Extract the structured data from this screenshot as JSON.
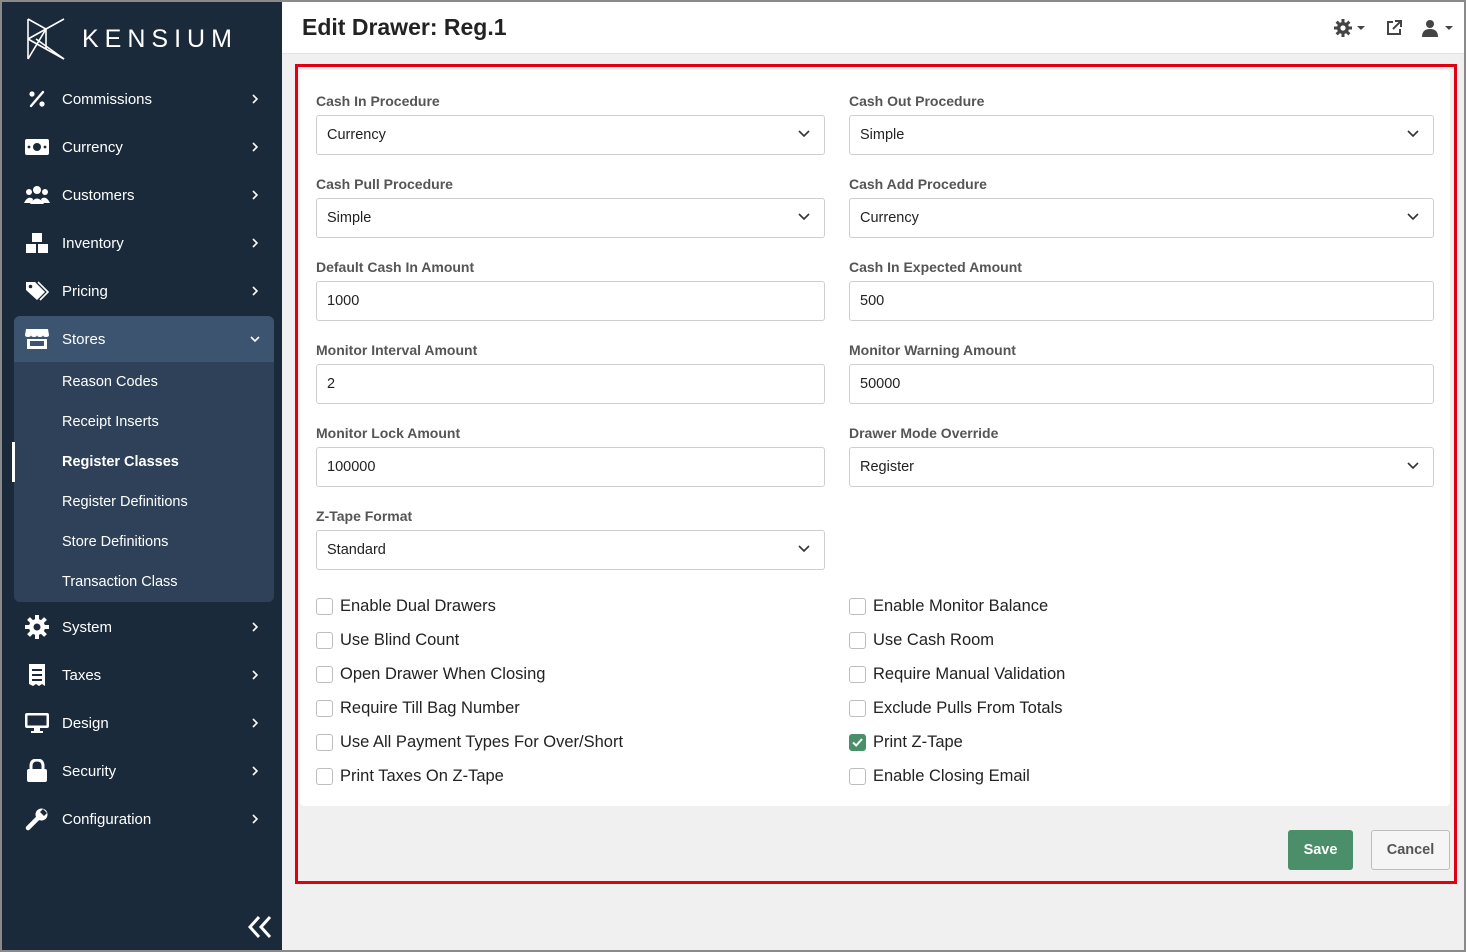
{
  "brand": {
    "name": "KENSIUM"
  },
  "sidebar": {
    "items": [
      {
        "label": "Commissions",
        "icon": "percent-icon"
      },
      {
        "label": "Currency",
        "icon": "money-bill-icon"
      },
      {
        "label": "Customers",
        "icon": "users-icon"
      },
      {
        "label": "Inventory",
        "icon": "boxes-icon"
      },
      {
        "label": "Pricing",
        "icon": "tags-icon"
      },
      {
        "label": "Stores",
        "icon": "store-icon"
      },
      {
        "label": "System",
        "icon": "gear-icon"
      },
      {
        "label": "Taxes",
        "icon": "receipt-icon"
      },
      {
        "label": "Design",
        "icon": "desktop-icon"
      },
      {
        "label": "Security",
        "icon": "lock-icon"
      },
      {
        "label": "Configuration",
        "icon": "wrench-icon"
      }
    ],
    "stores_submenu": [
      "Reason Codes",
      "Receipt Inserts",
      "Register Classes",
      "Register Definitions",
      "Store Definitions",
      "Transaction Class"
    ],
    "current_submenu_item": "Register Classes"
  },
  "header": {
    "title": "Edit Drawer: Reg.1"
  },
  "form": {
    "fields": [
      {
        "label": "Cash In Procedure",
        "value": "Currency",
        "type": "select"
      },
      {
        "label": "Cash Out Procedure",
        "value": "Simple",
        "type": "select"
      },
      {
        "label": "Cash Pull Procedure",
        "value": "Simple",
        "type": "select"
      },
      {
        "label": "Cash Add Procedure",
        "value": "Currency",
        "type": "select"
      },
      {
        "label": "Default Cash In Amount",
        "value": "1000",
        "type": "input"
      },
      {
        "label": "Cash In Expected Amount",
        "value": "500",
        "type": "input"
      },
      {
        "label": "Monitor Interval Amount",
        "value": "2",
        "type": "input"
      },
      {
        "label": "Monitor Warning Amount",
        "value": "50000",
        "type": "input"
      },
      {
        "label": "Monitor Lock Amount",
        "value": "100000",
        "type": "input"
      },
      {
        "label": "Drawer Mode Override",
        "value": "Register",
        "type": "select"
      },
      {
        "label": "Z-Tape Format",
        "value": "Standard",
        "type": "select"
      }
    ],
    "checkboxes_left": [
      {
        "label": "Enable Dual Drawers",
        "checked": false
      },
      {
        "label": "Use Blind Count",
        "checked": false
      },
      {
        "label": "Open Drawer When Closing",
        "checked": false
      },
      {
        "label": "Require Till Bag Number",
        "checked": false
      },
      {
        "label": "Use All Payment Types For Over/Short",
        "checked": false
      },
      {
        "label": "Print Taxes On Z-Tape",
        "checked": false
      }
    ],
    "checkboxes_right": [
      {
        "label": "Enable Monitor Balance",
        "checked": false
      },
      {
        "label": "Use Cash Room",
        "checked": false
      },
      {
        "label": "Require Manual Validation",
        "checked": false
      },
      {
        "label": "Exclude Pulls From Totals",
        "checked": false
      },
      {
        "label": "Print Z-Tape",
        "checked": true
      },
      {
        "label": "Enable Closing Email",
        "checked": false
      }
    ]
  },
  "actions": {
    "save": "Save",
    "cancel": "Cancel"
  },
  "colors": {
    "sidebar_bg": "#1b2a3b",
    "active_bg": "#3d5470",
    "accent": "#4a8f6a",
    "highlight": "#e00012"
  }
}
